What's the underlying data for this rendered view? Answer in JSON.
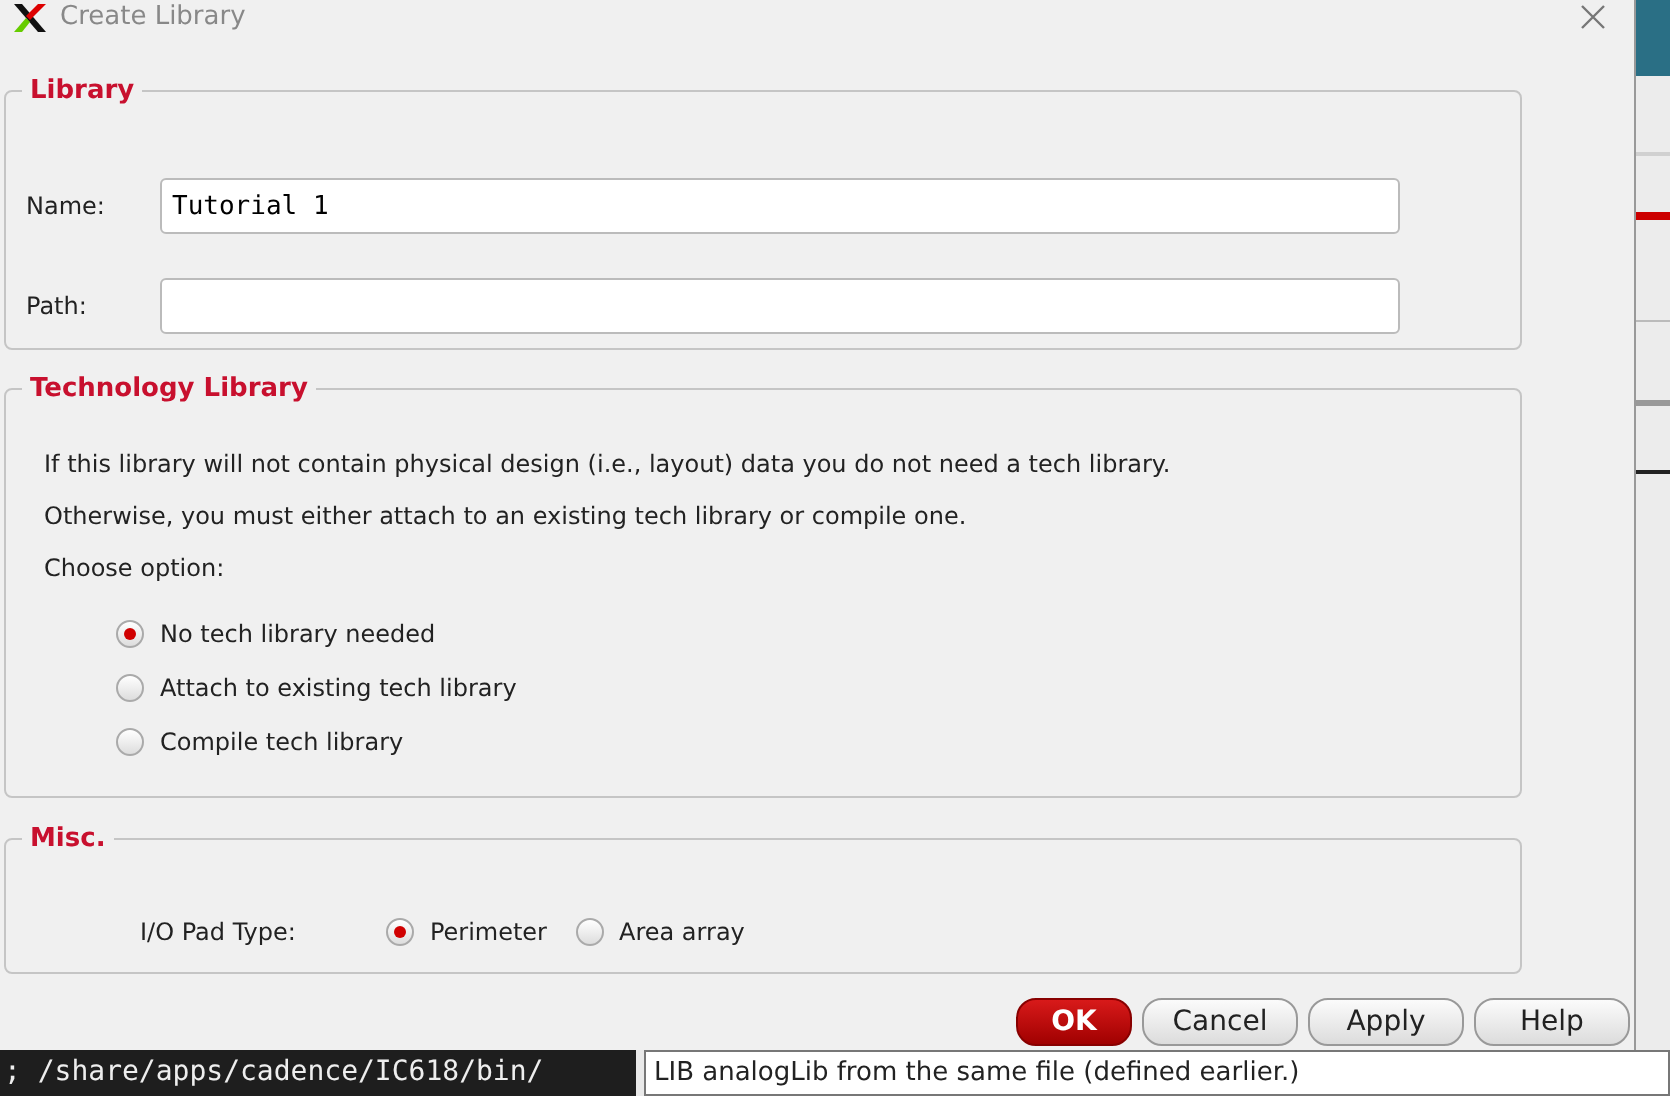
{
  "window": {
    "title": "Create Library"
  },
  "library": {
    "legend": "Library",
    "fields": [
      {
        "label": "Name:",
        "value": "Tutorial 1"
      },
      {
        "label": "Path:"
      }
    ]
  },
  "technology": {
    "legend": "Technology Library",
    "lines": [
      "If this library will not contain physical design (i.e., layout) data you do not need a tech library.",
      "Otherwise, you must either attach to an existing tech library or compile one.",
      "Choose option:"
    ],
    "options": [
      {
        "label": "No tech library needed",
        "selected": true
      },
      {
        "label": "Attach to existing tech library",
        "selected": false
      },
      {
        "label": "Compile tech library",
        "selected": false
      }
    ]
  },
  "misc": {
    "legend": "Misc.",
    "label": "I/O Pad Type:",
    "options": [
      {
        "label": "Perimeter",
        "selected": true
      },
      {
        "label": "Area array",
        "selected": false
      }
    ]
  },
  "buttons": [
    {
      "label": "OK",
      "kind": "primary"
    },
    {
      "label": "Cancel",
      "kind": "default"
    },
    {
      "label": "Apply",
      "kind": "default"
    },
    {
      "label": "Help",
      "kind": "default"
    }
  ],
  "terminal": {
    "text": "; /share/apps/cadence/IC618/bin/"
  },
  "status_field": {
    "value": "LIB analogLib from the same file (defined earlier.)"
  }
}
